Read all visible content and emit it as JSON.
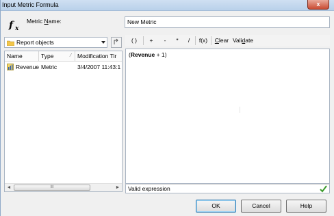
{
  "window": {
    "title": "Input Metric Formula",
    "close_glyph": "x"
  },
  "metric_name": {
    "label_prefix": "Metric ",
    "label_underlined": "N",
    "label_suffix": "ame:",
    "value": "New Metric"
  },
  "object_browser": {
    "dropdown_label": "Report objects",
    "columns": [
      "Name",
      "Type",
      "Modification Tir"
    ],
    "rows": [
      {
        "name": "Revenue",
        "type": "Metric",
        "modified": "3/4/2007 11:43:1"
      }
    ],
    "scroll_left": "◄",
    "scroll_thumb": "III",
    "scroll_right": "►"
  },
  "toolbar": {
    "paren": "( )",
    "plus": "+",
    "minus": "-",
    "multiply": "*",
    "divide": "/",
    "fx": "f(x)",
    "clear_underlined": "C",
    "clear_rest": "lear",
    "validate_prefix": "Vali",
    "validate_underlined": "d",
    "validate_suffix": "ate"
  },
  "formula": {
    "open": "(",
    "object": "Revenue",
    "rest": " + 1)"
  },
  "status": {
    "text": "Valid expression",
    "icon": "check-icon",
    "icon_color": "#3a9a2a"
  },
  "buttons": {
    "ok": "OK",
    "cancel": "Cancel",
    "help": "Help"
  }
}
